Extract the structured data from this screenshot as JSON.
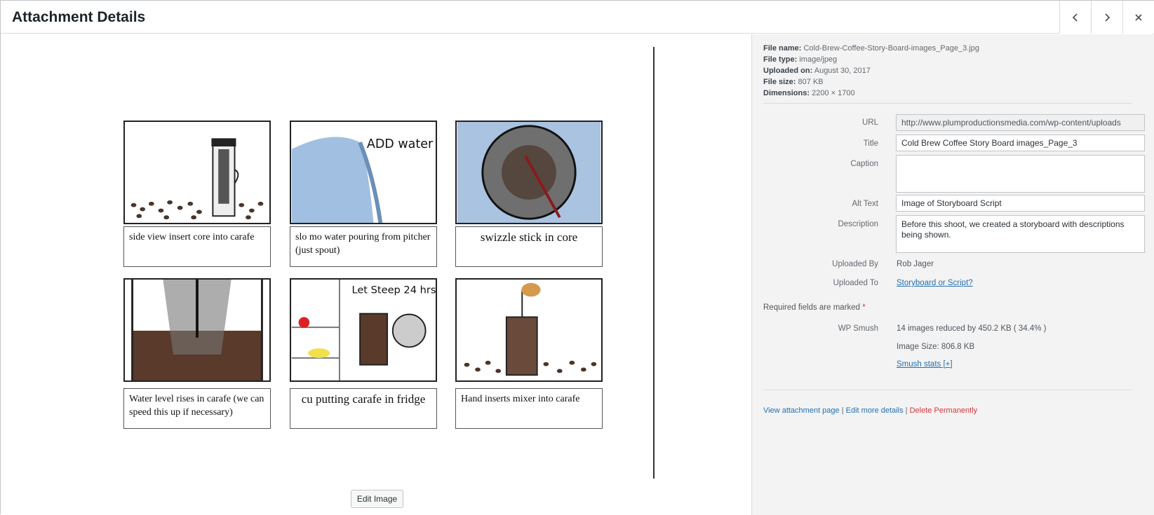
{
  "header": {
    "title": "Attachment Details",
    "prev_icon": "chevron-left-icon",
    "next_icon": "chevron-right-icon",
    "close_icon": "close-icon"
  },
  "storyboard": {
    "frames": [
      {
        "caption": "side view insert core into carafe"
      },
      {
        "caption": "slo mo water pouring from pitcher (just spout)",
        "drawn_text": "ADD water"
      },
      {
        "caption": "swizzle stick in core"
      },
      {
        "caption": "Water level rises in carafe (we can speed this up if necessary)"
      },
      {
        "caption": "cu putting carafe in fridge",
        "drawn_text": "Let Steep 24 hrs"
      },
      {
        "caption": "Hand inserts mixer into carafe"
      }
    ]
  },
  "edit_image_label": "Edit Image",
  "file_info": {
    "name_label": "File name:",
    "name": "Cold-Brew-Coffee-Story-Board-images_Page_3.jpg",
    "type_label": "File type:",
    "type": "image/jpeg",
    "uploaded_label": "Uploaded on:",
    "uploaded": "August 30, 2017",
    "size_label": "File size:",
    "size": "807 KB",
    "dims_label": "Dimensions:",
    "dims": "2200 × 1700"
  },
  "fields": {
    "url_label": "URL",
    "url": "http://www.plumproductionsmedia.com/wp-content/uploads",
    "title_label": "Title",
    "title": "Cold Brew Coffee Story Board images_Page_3",
    "caption_label": "Caption",
    "caption": "",
    "alt_label": "Alt Text",
    "alt": "Image of Storyboard Script",
    "desc_label": "Description",
    "desc": "Before this shoot, we created a storyboard with descriptions being shown.",
    "uploaded_by_label": "Uploaded By",
    "uploaded_by": "Rob Jager",
    "uploaded_to_label": "Uploaded To",
    "uploaded_to": "Storyboard or Script?"
  },
  "required_note": "Required fields are marked",
  "required_star": "*",
  "smush": {
    "label": "WP Smush",
    "reduced": "14 images reduced by 450.2 KB ( 34.4% )",
    "image_size": "Image Size: 806.8 KB",
    "stats_link": "Smush stats [+]"
  },
  "actions": {
    "view": "View attachment page",
    "sep": "|",
    "edit": "Edit more details",
    "delete": "Delete Permanently"
  },
  "colors": {
    "link": "#2271b1",
    "danger": "#d63638",
    "sidebar_bg": "#f3f3f3"
  }
}
